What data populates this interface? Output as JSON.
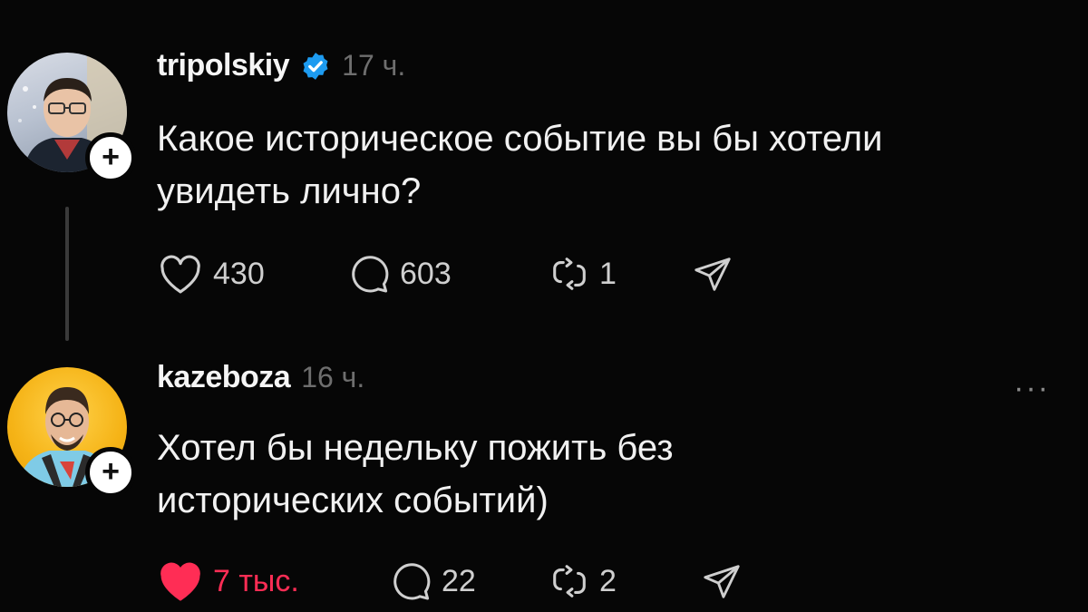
{
  "posts": [
    {
      "username": "tripolskiy",
      "verified": true,
      "time": "17 ч.",
      "text_lines": [
        "Какое историческое событие вы бы хотели",
        "увидеть лично?"
      ],
      "likes": "430",
      "replies": "603",
      "reposts": "1",
      "liked": false,
      "icons": [
        "heart-icon",
        "comment-icon",
        "repost-icon",
        "share-icon"
      ]
    },
    {
      "username": "kazeboza",
      "verified": false,
      "time": "16 ч.",
      "more": "···",
      "text_lines": [
        "Хотел бы недельку пожить без",
        "исторических событий)"
      ],
      "likes": "7 тыс.",
      "replies": "22",
      "reposts": "2",
      "liked": true,
      "icons": [
        "heart-filled-icon",
        "comment-icon",
        "repost-icon",
        "share-icon"
      ]
    }
  ],
  "follow_badge": "+",
  "colors": {
    "background": "#060606",
    "verified": "#1d9bf0",
    "like_active": "#ff2d55",
    "muted": "#6e6e6e"
  }
}
